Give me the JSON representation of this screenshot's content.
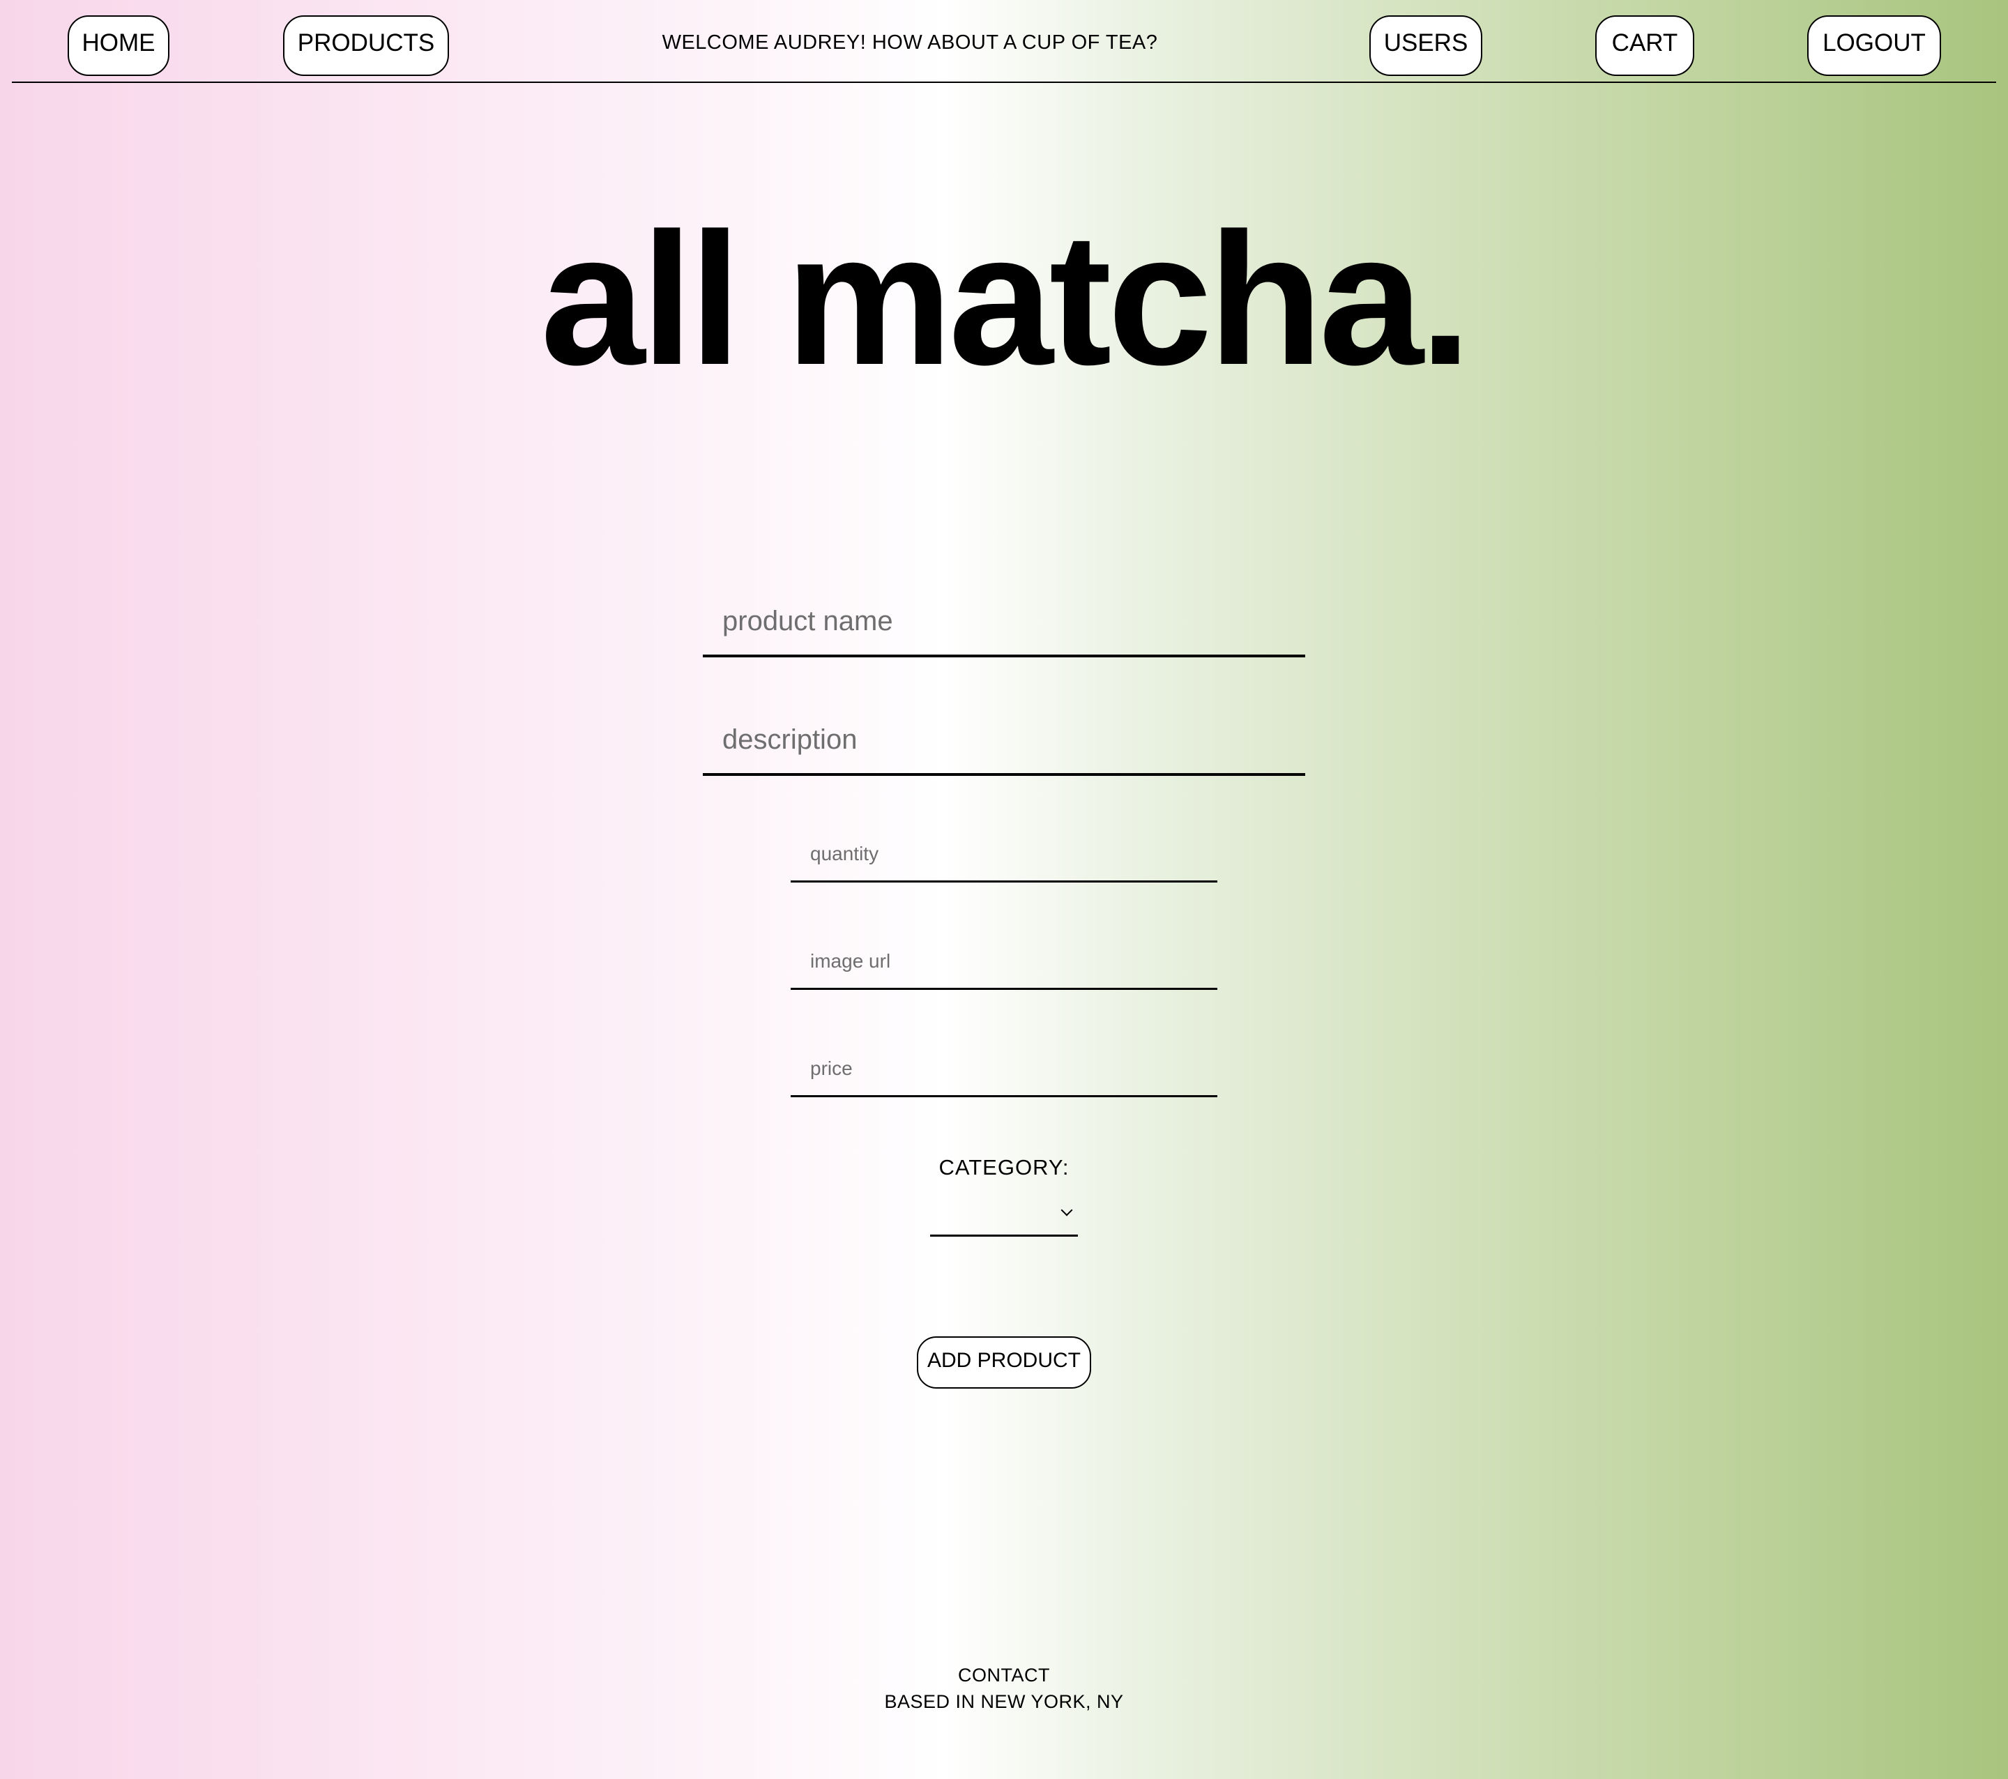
{
  "nav": {
    "home": "HOME",
    "products": "PRODUCTS",
    "welcome": "WELCOME AUDREY! HOW ABOUT A CUP OF TEA?",
    "users": "USERS",
    "cart": "CART",
    "logout": "LOGOUT"
  },
  "brand": {
    "logo_text": "all matcha."
  },
  "form": {
    "product_name": {
      "value": "",
      "placeholder": "product name"
    },
    "description": {
      "value": "",
      "placeholder": "description"
    },
    "quantity": {
      "value": "",
      "placeholder": "quantity"
    },
    "image_url": {
      "value": "",
      "placeholder": "image url"
    },
    "price": {
      "value": "",
      "placeholder": "price"
    },
    "category_label": "CATEGORY:",
    "category_selected": "",
    "submit_label": "ADD PRODUCT"
  },
  "footer": {
    "contact": "CONTACT",
    "location": "BASED IN NEW YORK, NY"
  },
  "colors": {
    "gradient_left": "#f8d6ea",
    "gradient_center": "#ffffff",
    "gradient_right": "#a8c47e",
    "ink": "#000000",
    "placeholder": "#6e6e6e"
  },
  "icons": {
    "category_dropdown": "chevron-down-icon"
  }
}
